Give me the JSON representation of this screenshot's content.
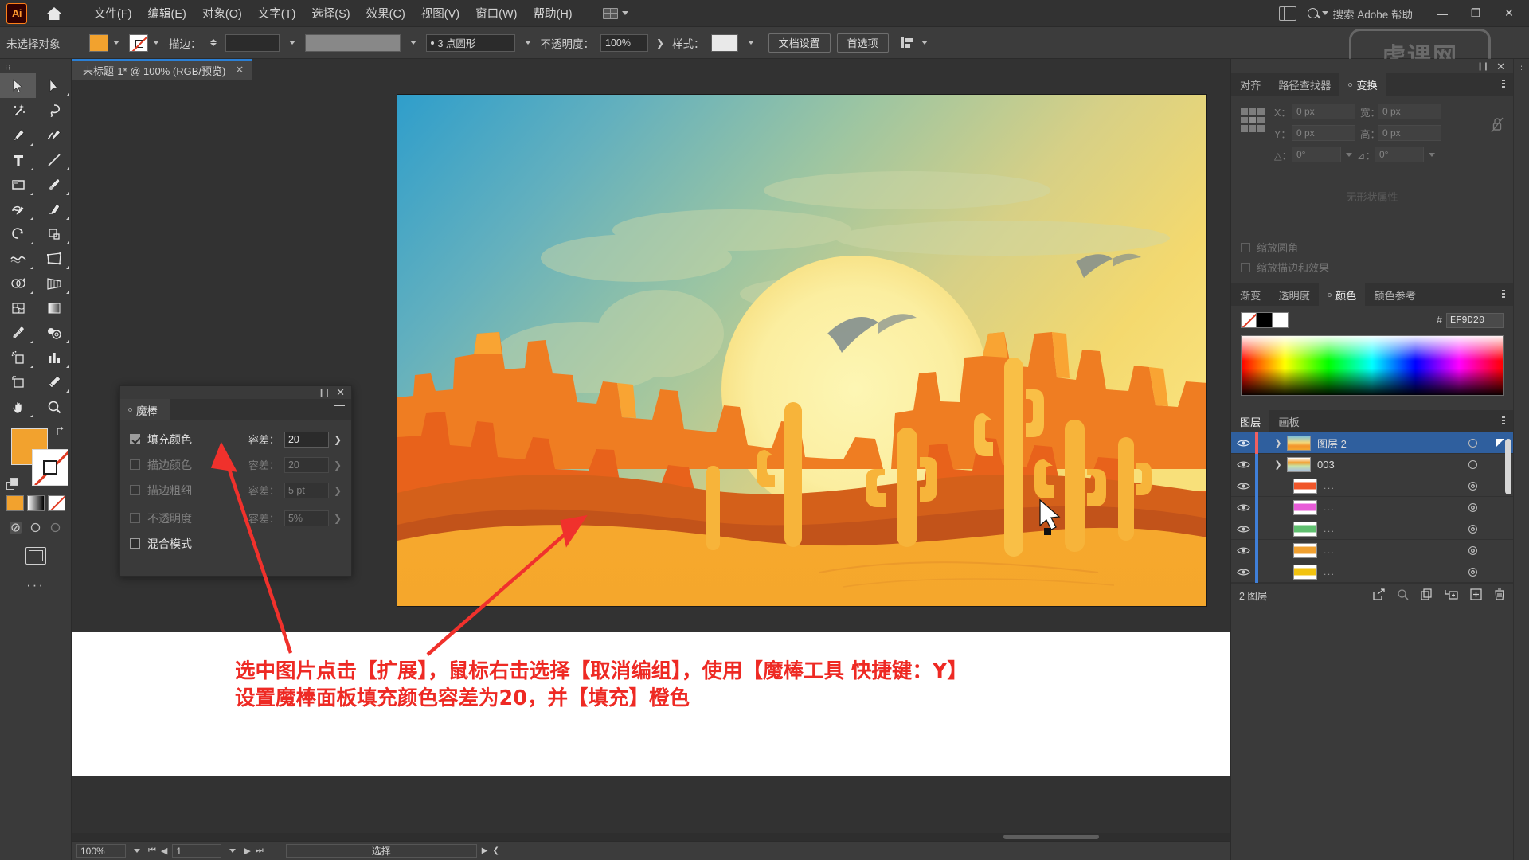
{
  "app": {
    "name": "Adobe Illustrator",
    "logo_text": "Ai",
    "home_icon": "home-icon"
  },
  "menubar": {
    "items": [
      {
        "label": "文件(F)"
      },
      {
        "label": "编辑(E)"
      },
      {
        "label": "对象(O)"
      },
      {
        "label": "文字(T)"
      },
      {
        "label": "选择(S)"
      },
      {
        "label": "效果(C)"
      },
      {
        "label": "视图(V)"
      },
      {
        "label": "窗口(W)"
      },
      {
        "label": "帮助(H)"
      }
    ],
    "search_placeholder": "搜索 Adobe 帮助",
    "window_controls": {
      "minimize": "—",
      "restore": "❐",
      "close": "✕"
    }
  },
  "controlbar": {
    "selection_status": "未选择对象",
    "stroke_label": "描边：",
    "stroke_weight": "",
    "stroke_profile": "",
    "brush_definition": "3 点圆形",
    "opacity_label": "不透明度：",
    "opacity_value": "100%",
    "style_label": "样式：",
    "document_setup": "文档设置",
    "preferences": "首选项"
  },
  "watermark": "虎课网",
  "doctab": {
    "title": "未标题-1* @ 100% (RGB/预览)",
    "close": "✕"
  },
  "toolbar": {
    "tools": [
      {
        "name": "selection-tool",
        "glyph": "selection"
      },
      {
        "name": "direct-selection-tool",
        "glyph": "direct-selection"
      },
      {
        "name": "magic-wand-tool",
        "glyph": "magic-wand"
      },
      {
        "name": "lasso-tool",
        "glyph": "lasso"
      },
      {
        "name": "pen-tool",
        "glyph": "pen"
      },
      {
        "name": "curvature-tool",
        "glyph": "curvature"
      },
      {
        "name": "type-tool",
        "glyph": "type"
      },
      {
        "name": "line-segment-tool",
        "glyph": "line"
      },
      {
        "name": "rectangle-tool",
        "glyph": "rectangle"
      },
      {
        "name": "paintbrush-tool",
        "glyph": "paintbrush"
      },
      {
        "name": "shaper-tool",
        "glyph": "shaper"
      },
      {
        "name": "eraser-tool",
        "glyph": "eraser"
      },
      {
        "name": "rotate-tool",
        "glyph": "rotate"
      },
      {
        "name": "scale-tool",
        "glyph": "scale"
      },
      {
        "name": "width-tool",
        "glyph": "width"
      },
      {
        "name": "free-transform-tool",
        "glyph": "free-transform"
      },
      {
        "name": "shape-builder-tool",
        "glyph": "shape-builder"
      },
      {
        "name": "perspective-grid-tool",
        "glyph": "perspective"
      },
      {
        "name": "mesh-tool",
        "glyph": "mesh"
      },
      {
        "name": "gradient-tool",
        "glyph": "gradient"
      },
      {
        "name": "eyedropper-tool",
        "glyph": "eyedropper"
      },
      {
        "name": "blend-tool",
        "glyph": "blend"
      },
      {
        "name": "symbol-sprayer-tool",
        "glyph": "symbol-sprayer"
      },
      {
        "name": "column-graph-tool",
        "glyph": "column-graph"
      },
      {
        "name": "artboard-tool",
        "glyph": "artboard"
      },
      {
        "name": "slice-tool",
        "glyph": "slice"
      },
      {
        "name": "hand-tool",
        "glyph": "hand"
      },
      {
        "name": "zoom-tool",
        "glyph": "zoom"
      }
    ],
    "fill_color": "#F2A22E",
    "stroke_color": "none",
    "more_tools": "···"
  },
  "magicwand_panel": {
    "tab_label": "魔棒",
    "rows": [
      {
        "label": "填充颜色",
        "checked": true,
        "tolerance_label": "容差：",
        "tolerance_value": "20",
        "enabled": true
      },
      {
        "label": "描边颜色",
        "checked": false,
        "tolerance_label": "容差：",
        "tolerance_value": "20",
        "enabled": false
      },
      {
        "label": "描边粗细",
        "checked": false,
        "tolerance_label": "容差：",
        "tolerance_value": "5 pt",
        "enabled": false
      },
      {
        "label": "不透明度",
        "checked": false,
        "tolerance_label": "容差：",
        "tolerance_value": "5%",
        "enabled": false
      },
      {
        "label": "混合模式",
        "checked": false,
        "tolerance_label": "",
        "tolerance_value": "",
        "enabled": false
      }
    ]
  },
  "annotation": {
    "line1": "选中图片点击【扩展】，鼠标右击选择【取消编组】，使用【魔棒工具 快捷键：Y】",
    "line2": "设置魔棒面板填充颜色容差为20，并【填充】橙色",
    "color": "#EE2A24"
  },
  "dock": {
    "transform_group": {
      "tabs": [
        {
          "label": "对齐",
          "active": false
        },
        {
          "label": "路径查找器",
          "active": false
        },
        {
          "label": "变换",
          "active": true
        }
      ],
      "fields": [
        {
          "label": "X：",
          "value": "0 px"
        },
        {
          "label": "Y：",
          "value": "0 px"
        },
        {
          "label": "宽：",
          "value": "0 px"
        },
        {
          "label": "高：",
          "value": "0 px"
        },
        {
          "label": "△：",
          "value": "0°"
        },
        {
          "label": "⊿：",
          "value": "0°"
        }
      ],
      "empty_text": "无形状属性",
      "checkboxes": [
        {
          "label": "缩放圆角",
          "checked": false
        },
        {
          "label": "缩放描边和效果",
          "checked": false
        }
      ]
    },
    "color_group": {
      "tabs": [
        {
          "label": "渐变",
          "active": false
        },
        {
          "label": "透明度",
          "active": false
        },
        {
          "label": "颜色",
          "active": true
        },
        {
          "label": "颜色参考",
          "active": false
        }
      ],
      "hash": "#",
      "hex_value": "EF9D20"
    },
    "layers_group": {
      "tabs": [
        {
          "label": "图层",
          "active": true
        },
        {
          "label": "画板",
          "active": false
        }
      ],
      "rows": [
        {
          "name": "图层 2",
          "selected": true,
          "indent": 0,
          "expandable": true,
          "expanded": false,
          "color": "#f06060",
          "thumb": "artwork",
          "visible": true
        },
        {
          "name": "003",
          "selected": false,
          "indent": 1,
          "expandable": true,
          "expanded": true,
          "color": "#4a7fd4",
          "thumb": "group",
          "visible": true
        },
        {
          "name": "...",
          "selected": false,
          "indent": 2,
          "expandable": false,
          "expanded": false,
          "color": "#4a7fd4",
          "thumb": "#f0562a",
          "visible": true
        },
        {
          "name": "...",
          "selected": false,
          "indent": 2,
          "expandable": false,
          "expanded": false,
          "color": "#4a7fd4",
          "thumb": "#e85cd8",
          "visible": true
        },
        {
          "name": "...",
          "selected": false,
          "indent": 2,
          "expandable": false,
          "expanded": false,
          "color": "#4a7fd4",
          "thumb": "#5fbf6f",
          "visible": true
        },
        {
          "name": "...",
          "selected": false,
          "indent": 2,
          "expandable": false,
          "expanded": false,
          "color": "#4a7fd4",
          "thumb": "#f0a030",
          "visible": true
        },
        {
          "name": "...",
          "selected": false,
          "indent": 2,
          "expandable": false,
          "expanded": false,
          "color": "#4a7fd4",
          "thumb": "#f2c310",
          "visible": true
        }
      ],
      "footer_count": "2 图层",
      "footer_icons": [
        "release-icon",
        "locate-icon",
        "collect-icon",
        "new-sublayer-icon",
        "new-layer-icon",
        "delete-icon"
      ]
    }
  },
  "statusbar": {
    "zoom": "100%",
    "page": "1",
    "status_text": "选择"
  },
  "artwork": {
    "title": "desert-sunset-illustration",
    "sky_top": "#3fa3cd",
    "sky_mid": "#8fc0a8",
    "sky_warm": "#f2d97a",
    "sun": "#fbf2a8",
    "mesa_dark": "#e8621b",
    "mesa_mid": "#f0822a",
    "dune_dark": "#c75018",
    "sand": "#f5a52b",
    "cactus": "#f7b43a"
  }
}
